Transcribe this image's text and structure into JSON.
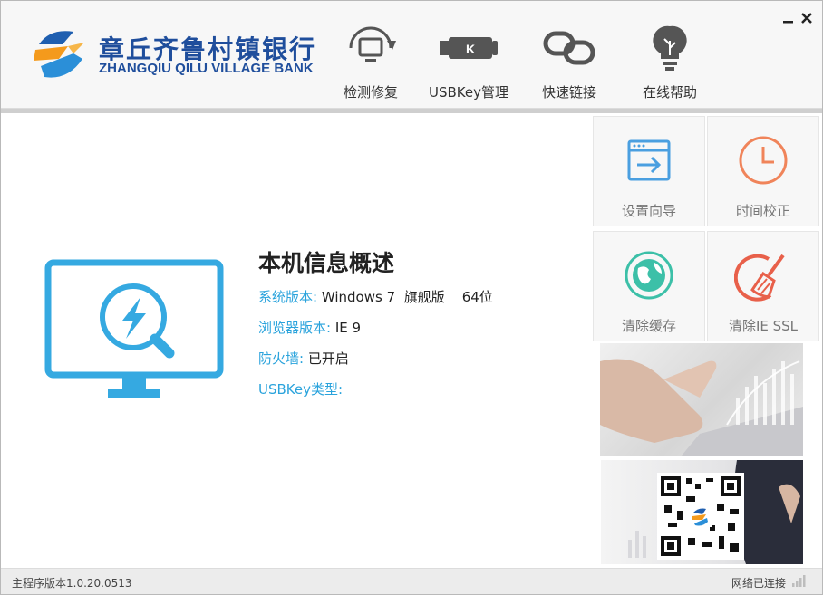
{
  "brand": {
    "name_cn": "章丘齐鲁村镇银行",
    "name_en": "ZHANGQIU QILU VILLAGE BANK"
  },
  "toolbar": [
    {
      "label": "检测修复",
      "icon": "monitor-refresh-icon"
    },
    {
      "label": "USBKey管理",
      "icon": "usbkey-icon"
    },
    {
      "label": "快速链接",
      "icon": "link-icon"
    },
    {
      "label": "在线帮助",
      "icon": "lightbulb-icon"
    }
  ],
  "window_controls": {
    "minimize": "minimize-icon",
    "close": "close-icon"
  },
  "info": {
    "title": "本机信息概述",
    "rows": [
      {
        "label": "系统版本:",
        "value": "Windows 7  旗舰版    64位"
      },
      {
        "label": "浏览器版本:",
        "value": "IE 9"
      },
      {
        "label": "防火墙:",
        "value": "已开启"
      },
      {
        "label": "USBKey类型:",
        "value": ""
      }
    ]
  },
  "tiles": [
    {
      "label": "设置向导",
      "icon": "setup-wizard-icon",
      "color": "#4a9fe0"
    },
    {
      "label": "时间校正",
      "icon": "clock-icon",
      "color": "#f0845a"
    },
    {
      "label": "清除缓存",
      "icon": "globe-icon",
      "color": "#3cc0a8"
    },
    {
      "label": "清除IE SSL",
      "icon": "broom-icon",
      "color": "#e8604a"
    }
  ],
  "status": {
    "version": "主程序版本1.0.20.0513",
    "network": "网络已连接"
  },
  "colors": {
    "brand_blue": "#1f4e9c",
    "accent_cyan": "#2aa3dc",
    "monitor_blue": "#35a9e1"
  }
}
